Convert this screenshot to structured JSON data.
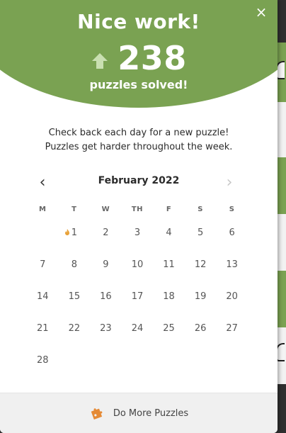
{
  "header": {
    "title": "Nice work!",
    "count": "238",
    "subtitle": "puzzles solved!",
    "close_symbol": "×"
  },
  "message": {
    "line1": "Check back each day for a new puzzle!",
    "line2": "Puzzles get harder throughout the week."
  },
  "calendar": {
    "month_label": "February 2022",
    "prev_symbol": "‹",
    "next_symbol": "›",
    "weekdays": [
      "M",
      "T",
      "W",
      "TH",
      "F",
      "S",
      "S"
    ],
    "weeks": [
      [
        "",
        "1",
        "2",
        "3",
        "4",
        "5",
        "6"
      ],
      [
        "7",
        "8",
        "9",
        "10",
        "11",
        "12",
        "13"
      ],
      [
        "14",
        "15",
        "16",
        "17",
        "18",
        "19",
        "20"
      ],
      [
        "21",
        "22",
        "23",
        "24",
        "25",
        "26",
        "27"
      ],
      [
        "28",
        "",
        "",
        "",
        "",
        "",
        ""
      ]
    ],
    "streak_marker_day": "1"
  },
  "footer": {
    "label": "Do More Puzzles",
    "icon": "puzzle-piece-icon"
  },
  "colors": {
    "brand_green": "#7aa252",
    "streak_flame": "#e8a23a",
    "footer_icon": "#e58a35"
  }
}
